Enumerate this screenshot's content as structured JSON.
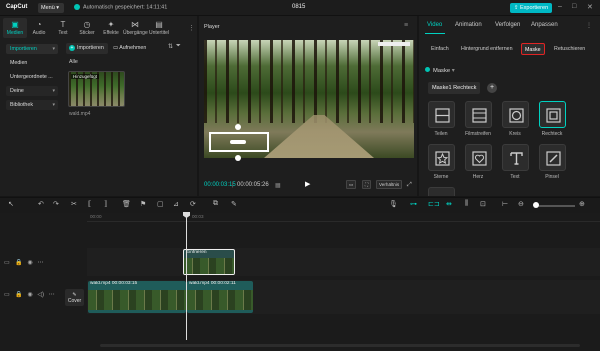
{
  "app": {
    "logo": "CapCut",
    "menu_label": "Menü",
    "saved_status": "Automatisch gespeichert: 14:11:41",
    "project_name": "0815",
    "export_label": "Exportieren"
  },
  "left": {
    "tabs": [
      {
        "label": "Medien",
        "icon": "media-icon"
      },
      {
        "label": "Audio",
        "icon": "audio-icon"
      },
      {
        "label": "Text",
        "icon": "text-icon"
      },
      {
        "label": "Sticker",
        "icon": "sticker-icon"
      },
      {
        "label": "Effekte",
        "icon": "effects-icon"
      },
      {
        "label": "Übergänge",
        "icon": "transitions-icon"
      },
      {
        "label": "Untertitel",
        "icon": "subtitles-icon"
      }
    ],
    "side": [
      "Importieren",
      "Medien",
      "Untergeordnete ...",
      "Deine",
      "Bibliothek"
    ],
    "import_label": "Importieren",
    "record_label": "Aufnehmen",
    "alle_label": "Alle",
    "thumb_tag": "Hinzugefügt",
    "thumb_name": "wald.mp4"
  },
  "player": {
    "label": "Player",
    "timecode_current": "00:00:03:15",
    "timecode_total": "00:00:05:26",
    "ratio_label": "Verhältnis"
  },
  "right": {
    "tabs": [
      "Video",
      "Animation",
      "Verfolgen",
      "Anpassen"
    ],
    "subtabs": [
      "Einfach",
      "Hintergrund entfernen",
      "Maske",
      "Retuschieren"
    ],
    "section": "Maske",
    "mask_name": "Maske1 Rechteck",
    "masks": [
      {
        "label": "Teilen",
        "icon": "split-mask-icon"
      },
      {
        "label": "Filmstreifen",
        "icon": "filmstrip-mask-icon"
      },
      {
        "label": "Kreis",
        "icon": "circle-mask-icon"
      },
      {
        "label": "Rechteck",
        "icon": "rectangle-mask-icon"
      },
      {
        "label": "Sterne",
        "icon": "star-mask-icon"
      },
      {
        "label": "Herz",
        "icon": "heart-mask-icon"
      },
      {
        "label": "Text",
        "icon": "text-mask-icon"
      },
      {
        "label": "Pinsel",
        "icon": "brush-mask-icon"
      }
    ]
  },
  "timeline": {
    "ticks": [
      "00:00",
      "00:03"
    ],
    "clip_top_label": "Einfrieren",
    "clip1_label": "wald.mp4   00:00:03:15",
    "clip2_label": "wald.mp4   00:00:02:11",
    "cover_label": "Cover"
  },
  "colors": {
    "accent": "#00d1c1",
    "highlight": "#e02424",
    "export": "#00b8c4"
  }
}
